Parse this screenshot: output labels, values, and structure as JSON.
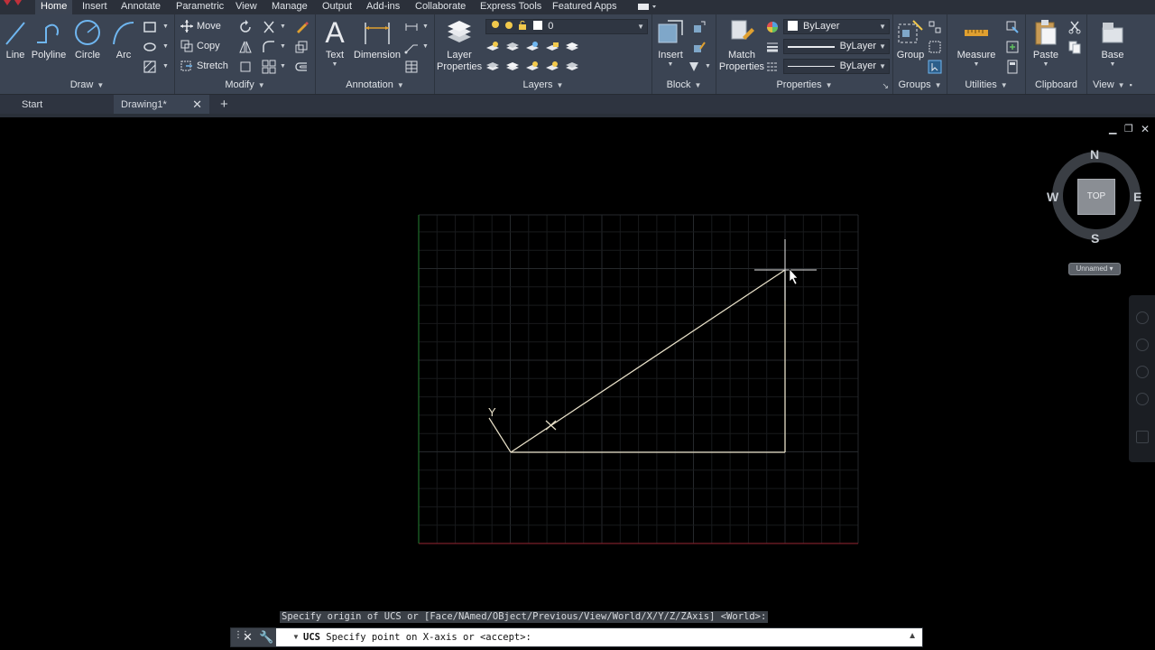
{
  "menu_tabs": [
    "Home",
    "Insert",
    "Annotate",
    "Parametric",
    "View",
    "Manage",
    "Output",
    "Add-ins",
    "Collaborate",
    "Express Tools",
    "Featured Apps"
  ],
  "active_menu_tab": "Home",
  "ribbon": {
    "draw": {
      "title": "Draw",
      "tools": [
        "Line",
        "Polyline",
        "Circle",
        "Arc"
      ]
    },
    "modify": {
      "title": "Modify",
      "move": "Move",
      "copy": "Copy",
      "stretch": "Stretch"
    },
    "annotation": {
      "title": "Annotation",
      "text": "Text",
      "dimension": "Dimension"
    },
    "layers": {
      "title": "Layers",
      "layer_properties_1": "Layer",
      "layer_properties_2": "Properties",
      "current_layer": "0"
    },
    "block": {
      "title": "Block",
      "insert": "Insert"
    },
    "properties": {
      "title": "Properties",
      "match_1": "Match",
      "match_2": "Properties",
      "color": "ByLayer",
      "linetype": "ByLayer",
      "lineweight": "ByLayer"
    },
    "groups": {
      "title": "Groups",
      "group": "Group"
    },
    "utilities": {
      "title": "Utilities",
      "measure": "Measure"
    },
    "clipboard": {
      "title": "Clipboard",
      "paste": "Paste"
    },
    "view": {
      "title": "View",
      "base": "Base"
    }
  },
  "file_tabs": [
    {
      "label": "Start",
      "active": false
    },
    {
      "label": "Drawing1*",
      "active": true
    }
  ],
  "viewcube": {
    "n": "N",
    "s": "S",
    "e": "E",
    "w": "W",
    "face": "TOP",
    "ucs_menu": "Unnamed"
  },
  "ucs_icon": {
    "y_label": "Y"
  },
  "command_line": {
    "history": "Specify origin of UCS or [Face/NAmed/OBject/Previous/View/World/X/Y/Z/ZAxis] <World>:",
    "command": "UCS",
    "prompt": "Specify point on X-axis or <accept>:"
  },
  "colors": {
    "ribbon_bg": "#3b4453",
    "menubar_bg": "#2b303a",
    "canvas_bg": "#000000",
    "drawn_line": "#e8e0c8",
    "grid_minor": "#181a1c",
    "grid_major": "#26292c",
    "axis_x": "#7a1f2a",
    "axis_y": "#1e6b2a"
  }
}
